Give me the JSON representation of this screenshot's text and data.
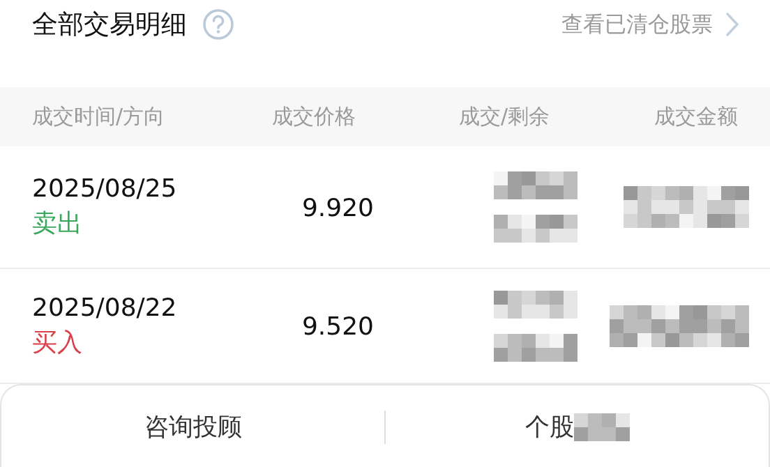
{
  "header": {
    "title": "全部交易明细",
    "link": "查看已清仓股票"
  },
  "table": {
    "columns": [
      "成交时间/方向",
      "成交价格",
      "成交/剩余",
      "成交金额"
    ],
    "rows": [
      {
        "date": "2025/08/25",
        "side": "卖出",
        "kind": "sell",
        "price": "9.920"
      },
      {
        "date": "2025/08/22",
        "side": "买入",
        "kind": "buy",
        "price": "9.520"
      }
    ]
  },
  "bottom_bar": {
    "buttons": [
      "咨询投顾",
      "个股"
    ]
  }
}
